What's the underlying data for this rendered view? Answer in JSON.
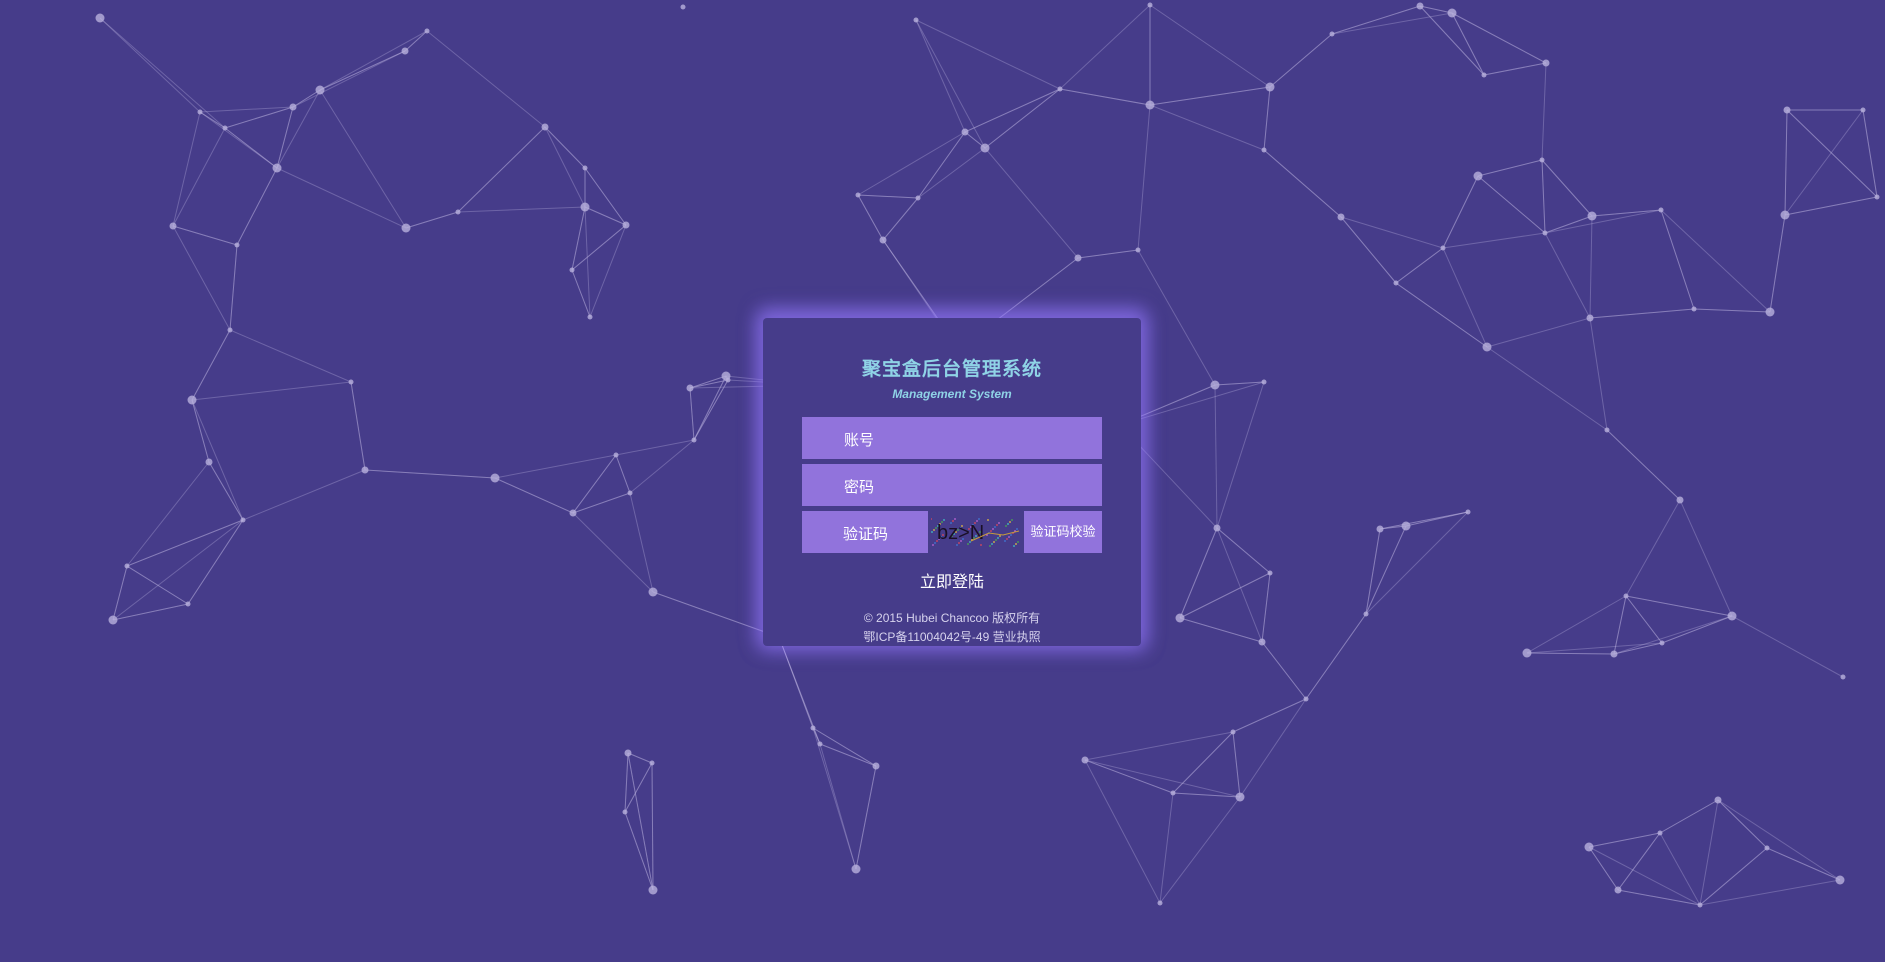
{
  "app": {
    "title": "聚宝盒后台管理系统",
    "subtitle": "Management System"
  },
  "form": {
    "account_placeholder": "账号",
    "password_placeholder": "密码",
    "captcha_placeholder": "验证码",
    "captcha_image_text": "bz>N",
    "verify_button": "验证码校验",
    "login_button": "立即登陆"
  },
  "footer": {
    "copyright": "© 2015 Hubei Chancoo 版权所有",
    "icp": "鄂ICP备11004042号-49 营业执照"
  },
  "colors": {
    "background": "#463c8a",
    "input_fill": "#9173dc",
    "title": "#8fd3e6",
    "network": "#b8b0dc"
  },
  "icons": {
    "background_decoration": "network-graph-icon"
  }
}
